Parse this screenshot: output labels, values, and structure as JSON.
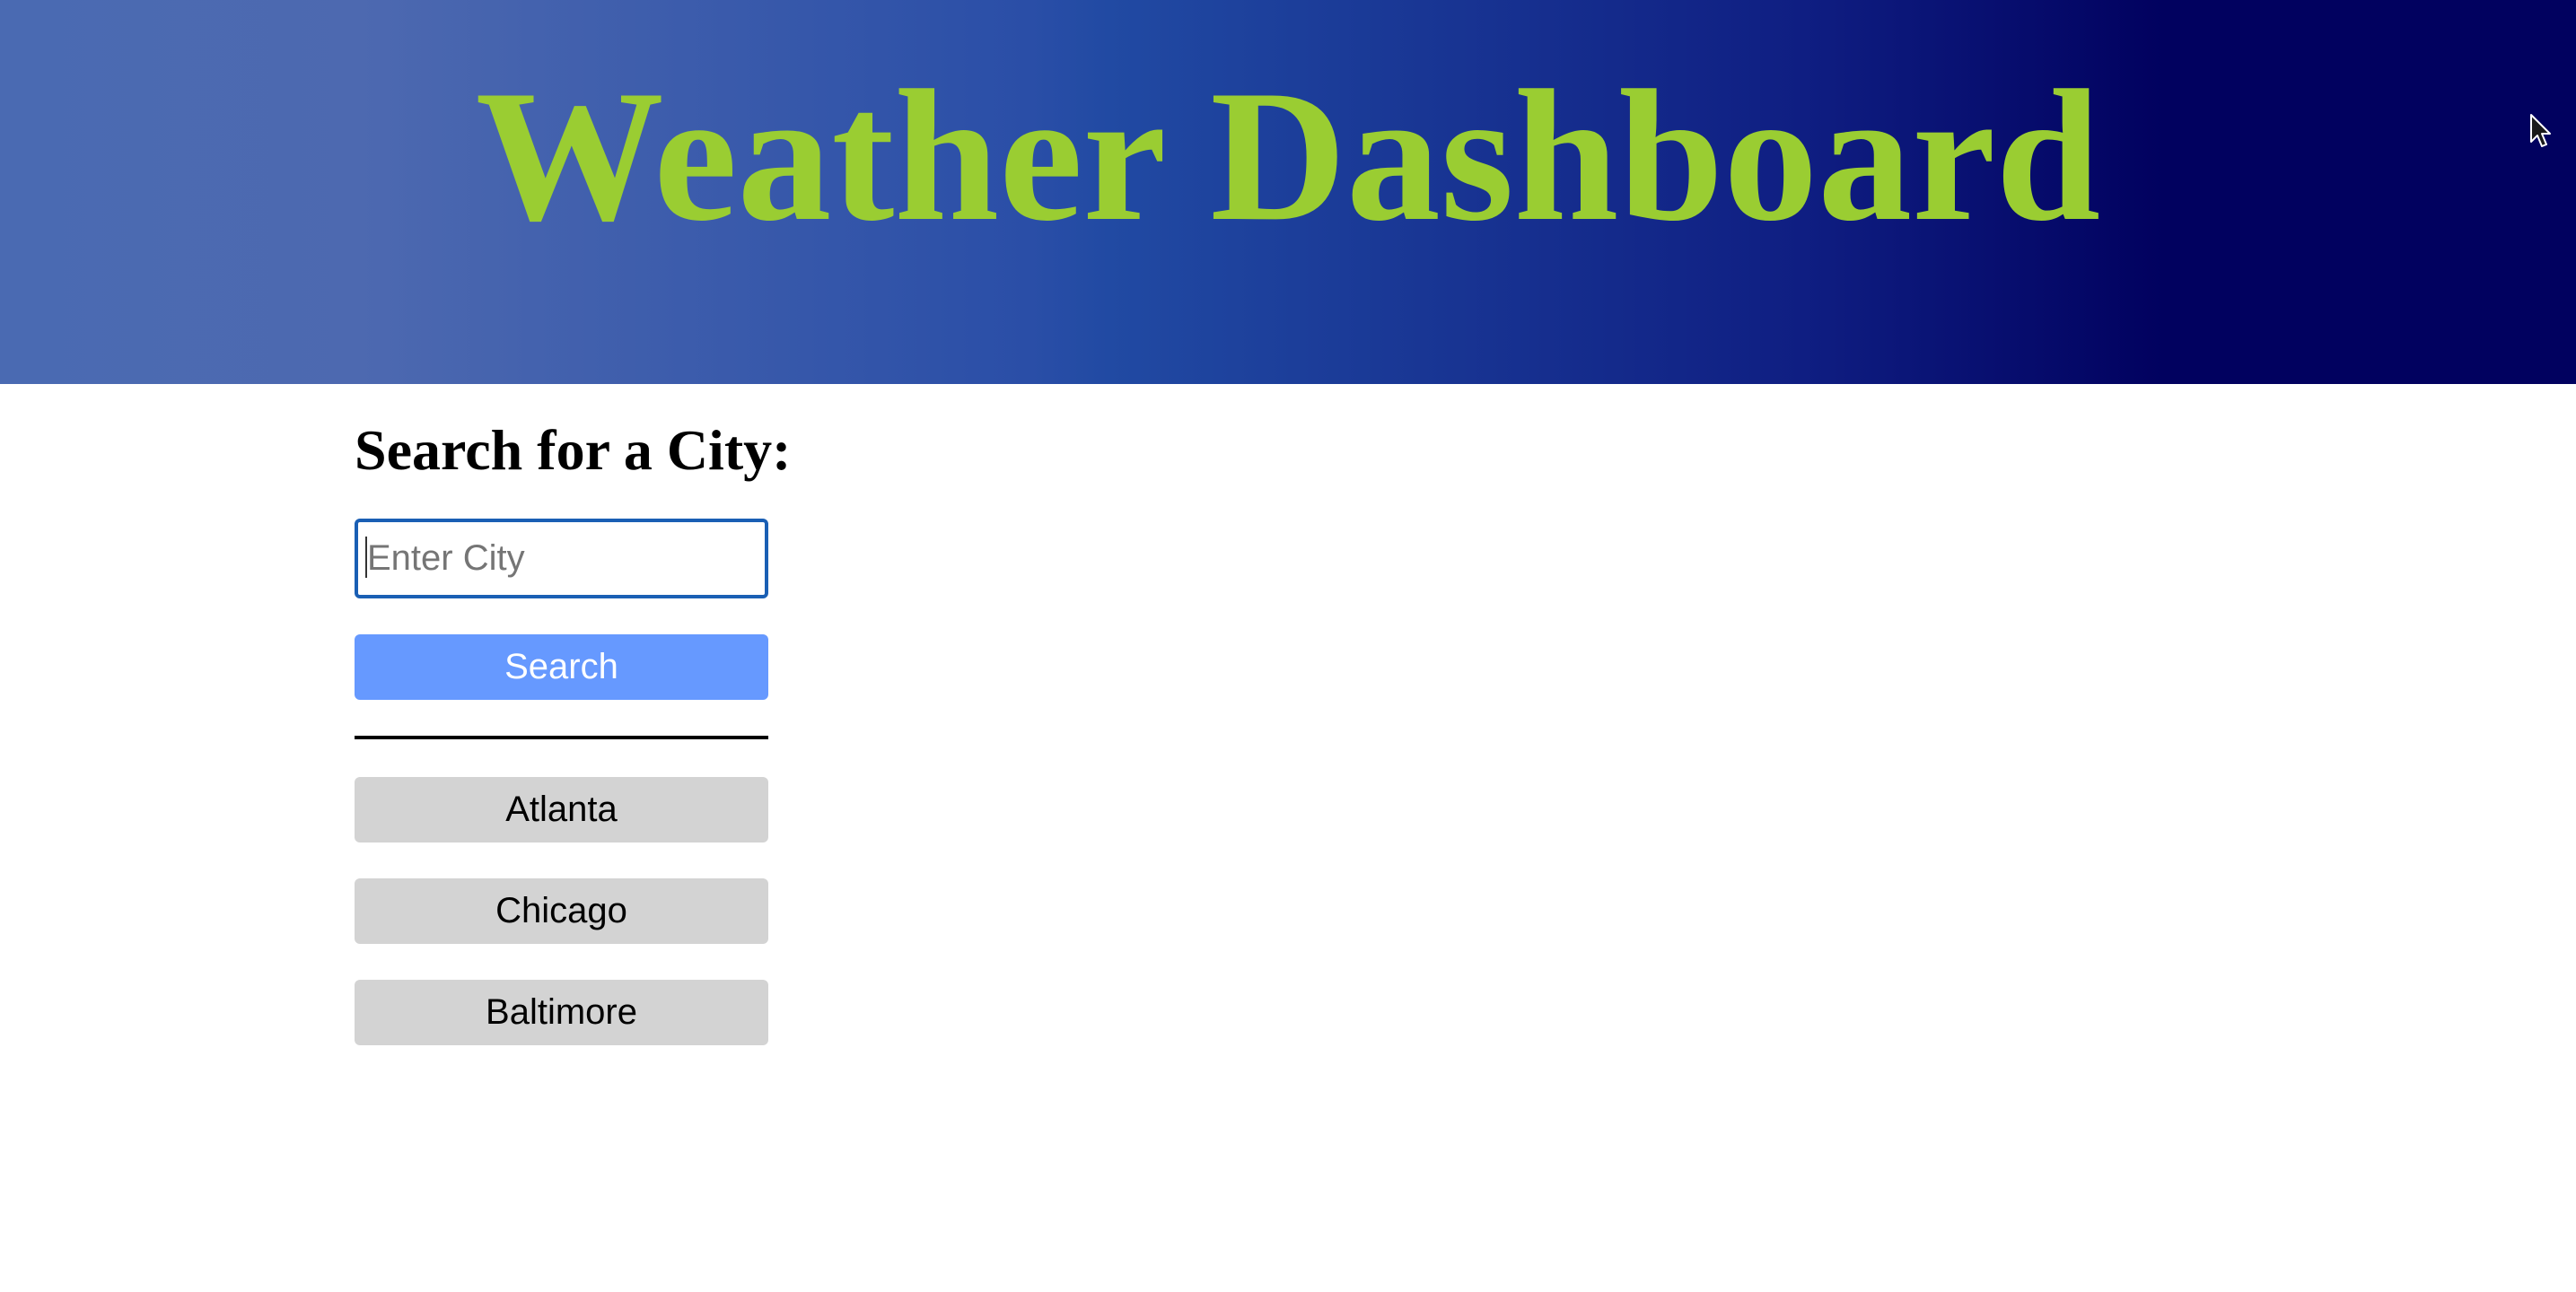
{
  "header": {
    "title": "Weather Dashboard"
  },
  "search": {
    "heading": "Search for a City:",
    "input_value": "",
    "placeholder": "Enter City",
    "button_label": "Search"
  },
  "history": {
    "items": [
      {
        "label": "Atlanta"
      },
      {
        "label": "Chicago"
      },
      {
        "label": "Baltimore"
      }
    ]
  },
  "colors": {
    "title": "#9acd32",
    "header_gradient_start": "#4a6ab2",
    "header_gradient_end": "#01015f",
    "search_button": "#6699ff",
    "history_button": "#d3d3d3",
    "input_focus_border": "#1a5fb4"
  },
  "icons": {
    "cursor": "mouse-pointer-icon"
  }
}
